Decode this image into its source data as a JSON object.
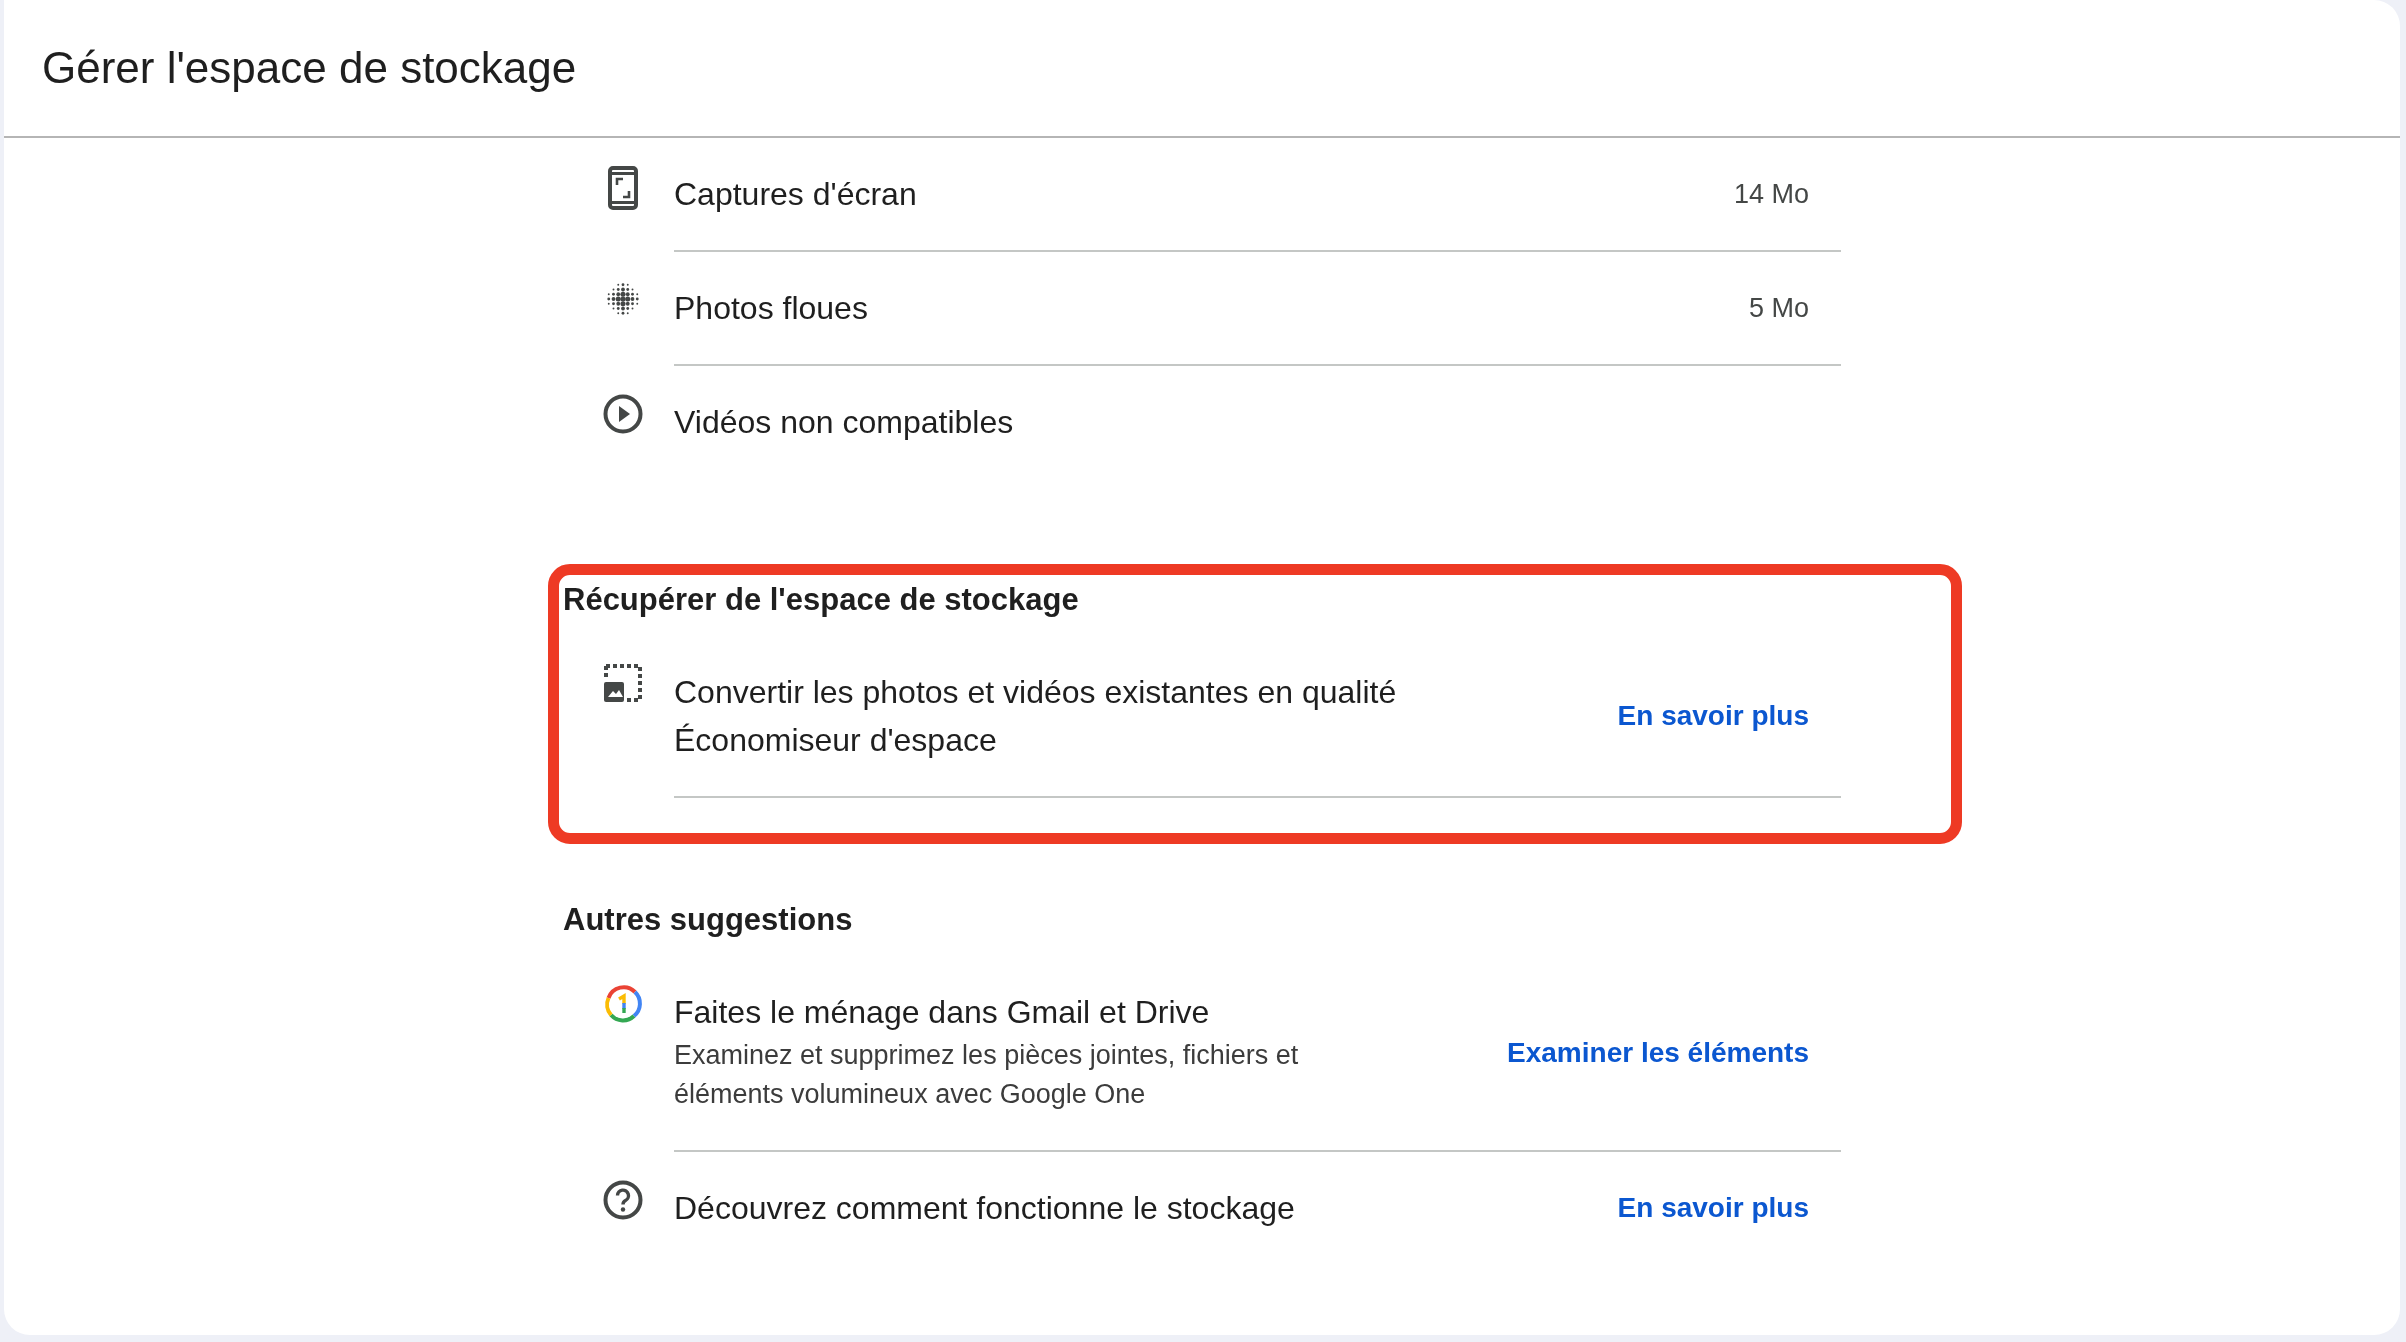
{
  "header": {
    "title": "Gérer l'espace de stockage"
  },
  "sections": [
    {
      "highlighted": false,
      "items": [
        {
          "title": "Captures d'écran",
          "size": "14 Mo"
        },
        {
          "title": "Photos floues",
          "size": "5 Mo"
        },
        {
          "title": "Vidéos non compatibles"
        }
      ]
    },
    {
      "heading": "Récupérer de l'espace de stockage",
      "highlighted": true,
      "items": [
        {
          "title": "Convertir les photos et vidéos existantes en qualité Économiseur d'espace",
          "link": "En savoir plus"
        }
      ]
    },
    {
      "heading": "Autres suggestions",
      "highlighted": false,
      "items": [
        {
          "title": "Faites le ménage dans Gmail et Drive",
          "subtitle": "Examinez et supprimez les pièces jointes, fichiers et éléments volumineux avec Google One",
          "link": "Examiner les éléments"
        },
        {
          "title": "Découvrez comment fonctionne le stockage",
          "link": "En savoir plus"
        }
      ]
    }
  ]
}
